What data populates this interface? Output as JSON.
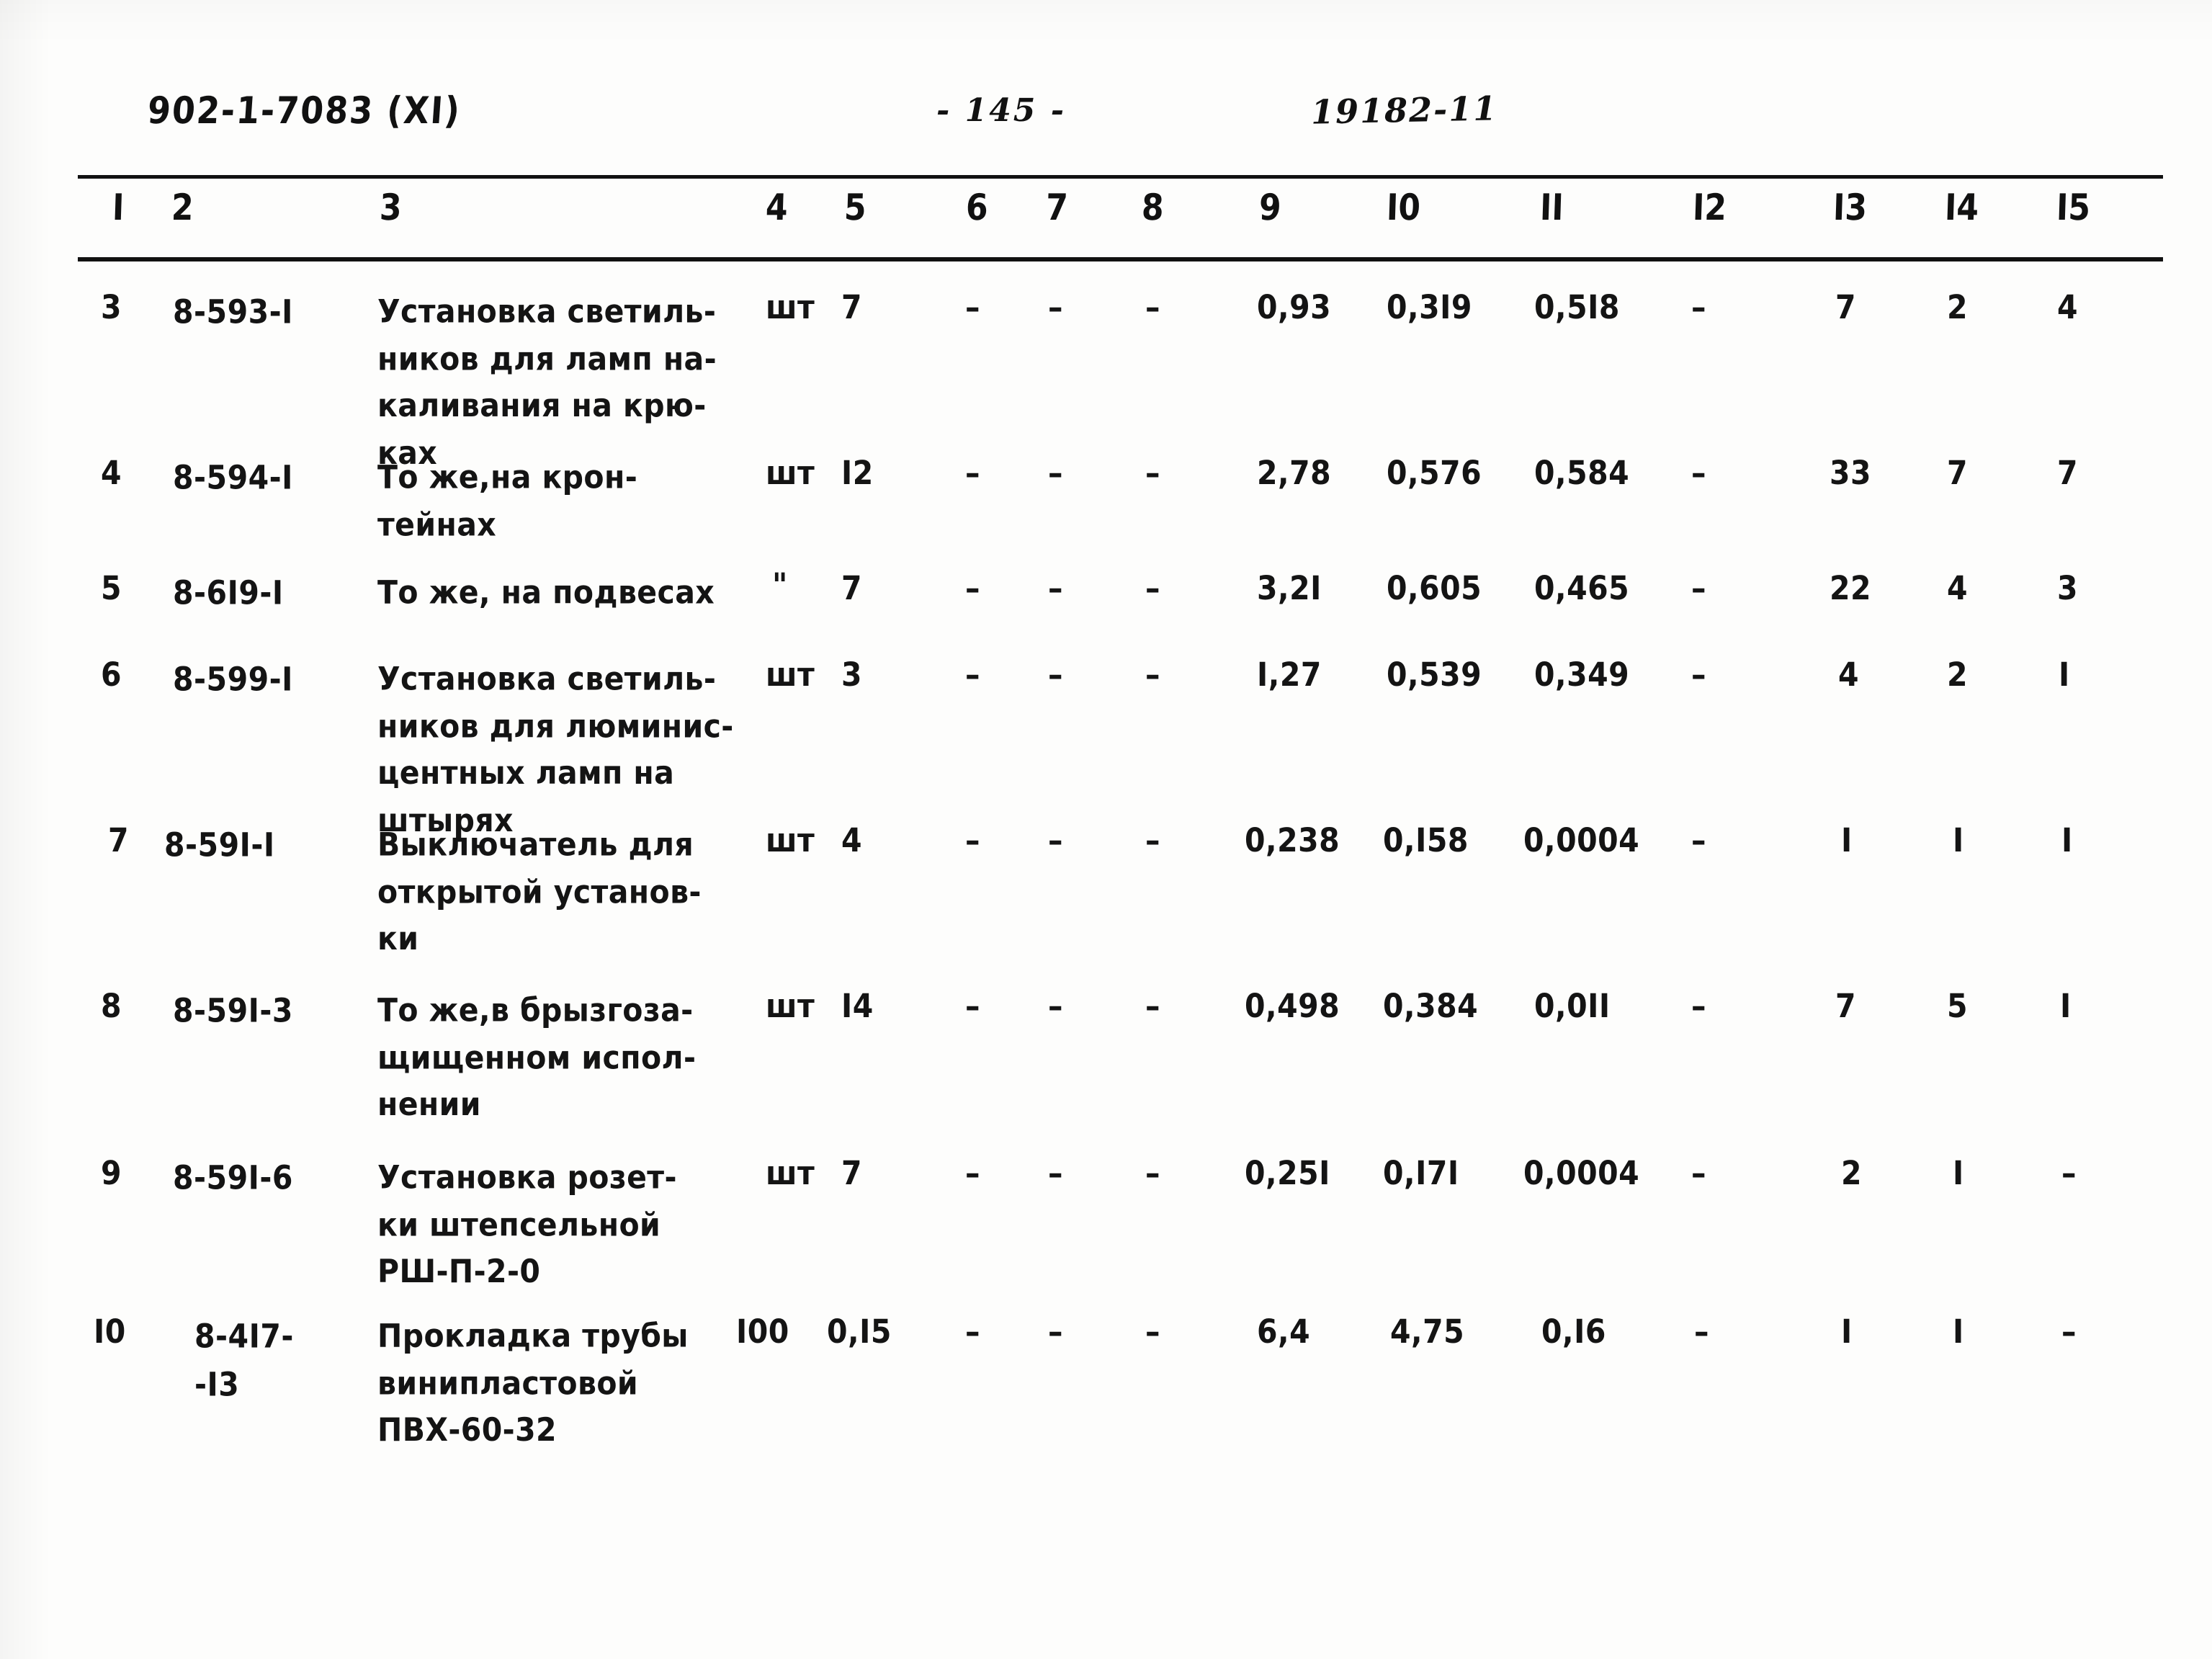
{
  "document": {
    "doc_code": "902-1-7083  (XI)",
    "page_number": "- 145 -",
    "sheet_code": "19182-11"
  },
  "table": {
    "column_headers": [
      "I",
      "2",
      "3",
      "4",
      "5",
      "6",
      "7",
      "8",
      "9",
      "I0",
      "II",
      "I2",
      "I3",
      "I4",
      "I5"
    ],
    "rows": [
      {
        "c1": "3",
        "c2": "8-593-I",
        "c3": "Установка светиль-\nников для ламп на-\nкаливания на крю-\nках",
        "c4": "шт",
        "c5": "7",
        "c6": "–",
        "c7": "–",
        "c8": "–",
        "c9": "0,93",
        "c10": "0,3I9",
        "c11": "0,5I8",
        "c12": "–",
        "c13": "7",
        "c14": "2",
        "c15": "4"
      },
      {
        "c1": "4",
        "c2": "8-594-I",
        "c3": "То же,на крон-\nтейнах",
        "c4": "шт",
        "c5": "I2",
        "c6": "–",
        "c7": "–",
        "c8": "–",
        "c9": "2,78",
        "c10": "0,576",
        "c11": "0,584",
        "c12": "–",
        "c13": "33",
        "c14": "7",
        "c15": "7"
      },
      {
        "c1": "5",
        "c2": "8-6I9-I",
        "c3": "То же, на подвесах",
        "c4": "\"",
        "c5": "7",
        "c6": "–",
        "c7": "–",
        "c8": "–",
        "c9": "3,2I",
        "c10": "0,605",
        "c11": "0,465",
        "c12": "–",
        "c13": "22",
        "c14": "4",
        "c15": "3"
      },
      {
        "c1": "6",
        "c2": "8-599-I",
        "c3": "Установка светиль-\nников для люминис-\nцентных ламп на\nштырях",
        "c4": "шт",
        "c5": "3",
        "c6": "–",
        "c7": "–",
        "c8": "–",
        "c9": "I,27",
        "c10": "0,539",
        "c11": "0,349",
        "c12": "–",
        "c13": "4",
        "c14": "2",
        "c15": "I"
      },
      {
        "c1": "7",
        "c2": "8-59I-I",
        "c3": "Выключатель для\nоткрытой установ-\nки",
        "c4": "шт",
        "c5": "4",
        "c6": "–",
        "c7": "–",
        "c8": "–",
        "c9": "0,238",
        "c10": "0,I58",
        "c11": "0,0004",
        "c12": "–",
        "c13": "I",
        "c14": "I",
        "c15": "I"
      },
      {
        "c1": "8",
        "c2": "8-59I-3",
        "c3": "То же,в брызгоза-\nщищенном испол-\nнении",
        "c4": "шт",
        "c5": "I4",
        "c6": "–",
        "c7": "–",
        "c8": "–",
        "c9": "0,498",
        "c10": "0,384",
        "c11": "0,0II",
        "c12": "–",
        "c13": "7",
        "c14": "5",
        "c15": "I"
      },
      {
        "c1": "9",
        "c2": "8-59I-6",
        "c3": "Установка розет-\nки штепсельной\nРШ-П-2-0",
        "c4": "шт",
        "c5": "7",
        "c6": "–",
        "c7": "–",
        "c8": "–",
        "c9": "0,25I",
        "c10": "0,I7I",
        "c11": "0,0004",
        "c12": "–",
        "c13": "2",
        "c14": "I",
        "c15": "–"
      },
      {
        "c1": "I0",
        "c2": "8-4I7-\n-I3",
        "c3": "Прокладка трубы\nвинипластовой\nПВХ-60-32",
        "c4": "I00",
        "c5": "0,I5",
        "c6": "–",
        "c7": "–",
        "c8": "–",
        "c9": "6,4",
        "c10": "4,75",
        "c11": "0,I6",
        "c12": "–",
        "c13": "I",
        "c14": "I",
        "c15": "–"
      }
    ]
  }
}
